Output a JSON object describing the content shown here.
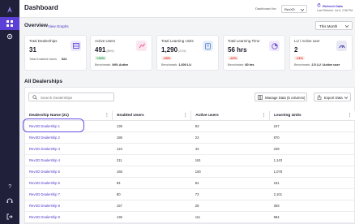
{
  "header": {
    "title": "Dashboard",
    "dealership_filter_label": "Dashboard for:",
    "dealership_filter_value": "RevXD",
    "refresh_label": "Refresh Data",
    "last_refresh": "Last Refresh: Jul 6, 2:58 PM"
  },
  "overview": {
    "title": "Overview",
    "view_graphs_label": "View Graphs",
    "period": "This Month"
  },
  "cards": [
    {
      "label": "Total Dealerships",
      "value": "31",
      "sub_label": "Total Enabled Users",
      "sub_value": "524",
      "icon": "table-icon",
      "color": "#5b3fd6"
    },
    {
      "label": "Active Users",
      "value": "491",
      "pct": "(86%)",
      "change": "+22%",
      "change_dir": "up",
      "bench_label": "Benchmark:",
      "bench_value": "94% Active",
      "icon": "chart-icon",
      "color": "#e84c8b"
    },
    {
      "label": "Total Learning Units",
      "value": "1,290",
      "pct": "(21%)",
      "change": "-15%",
      "change_dir": "down",
      "bench_label": "Benchmark:",
      "bench_value": "1,000 LU",
      "icon": "book-icon",
      "color": "#4a7bd0"
    },
    {
      "label": "Total Learning Time",
      "value": "56 hrs",
      "change": "-22%",
      "change_dir": "down",
      "bench_label": "Benchmark:",
      "bench_value": "80 hrs",
      "icon": "pie-icon",
      "color": "#7b5cd6"
    },
    {
      "label": "LU / Active user",
      "value": "2",
      "change": "-11%",
      "change_dir": "down",
      "bench_label": "Benchmark:",
      "bench_value": "2.5 LU / Active user",
      "icon": "gauge-icon",
      "color": "#3a3aa0"
    }
  ],
  "dealerships": {
    "title": "All Dealerships",
    "search_placeholder": "Search Dealerships",
    "manage_label": "Manage Data (5 columns)",
    "export_label": "Export Data",
    "columns": [
      "Dealership Name (21)",
      "Enabled Users",
      "Active users",
      "Learning Units"
    ],
    "rows": [
      [
        "RevXD Dealership 1",
        "139",
        "93",
        "247"
      ],
      [
        "RevXD Dealership 2",
        "188",
        "23",
        "970"
      ],
      [
        "RevXD Dealership 3",
        "123",
        "43",
        "249"
      ],
      [
        "RevXD Dealership 4",
        "211",
        "161",
        "1,143"
      ],
      [
        "RevXD Dealership 5",
        "168",
        "100",
        "1,078"
      ],
      [
        "RevXD Dealership 6",
        "84",
        "84",
        "181"
      ],
      [
        "RevXD Dealership 7",
        "80",
        "73",
        "2,101"
      ],
      [
        "RevXD Dealership 8",
        "157",
        "28",
        "393"
      ],
      [
        "RevXD Dealership 9",
        "136",
        "111",
        "984"
      ]
    ]
  }
}
